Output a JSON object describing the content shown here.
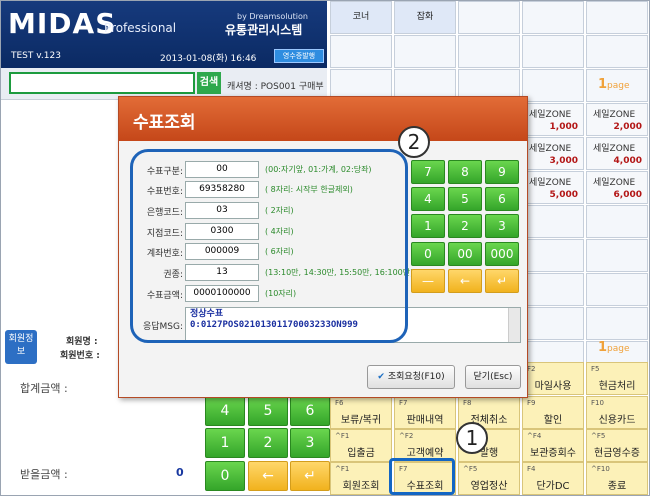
{
  "header": {
    "logo": "MIDAS",
    "logo_sub": "Professional",
    "by": "by Dreamsolution",
    "system": "유통관리시스템",
    "version": "TEST v.123",
    "datetime": "2013-01-08(화) 16:46",
    "receipt_btn": "영수증발행"
  },
  "search": {
    "button": "검색",
    "cashier": "캐셔명 : POS001 구매부"
  },
  "grid": {
    "top_tabs": [
      "코너",
      "잡화"
    ],
    "page1": "1",
    "page1_unit": "page",
    "page2": "1",
    "page2_unit": "page",
    "zones": [
      {
        "label": "세일ZONE",
        "price": "1,000"
      },
      {
        "label": "세일ZONE",
        "price": "2,000"
      },
      {
        "label": "세일ZONE",
        "price": "3,000"
      },
      {
        "label": "세일ZONE",
        "price": "4,000"
      },
      {
        "label": "세일ZONE",
        "price": "5,000"
      },
      {
        "label": "세일ZONE",
        "price": "6,000"
      }
    ]
  },
  "member": {
    "tab": "회원정보",
    "name_label": "회원명 :",
    "no_label": "회원번호 :"
  },
  "totals": {
    "total_label": "합계금액 :",
    "paid_label": "받을금액 :",
    "paid_value": "0"
  },
  "numpad": {
    "keys": [
      "4",
      "5",
      "6",
      "1",
      "2",
      "3",
      "0",
      "←",
      "↵"
    ]
  },
  "fkeys": [
    {
      "code": "F2",
      "label": "마일사용"
    },
    {
      "code": "F5",
      "label": "현금처리"
    },
    {
      "code": "F6",
      "label": "보류/복귀"
    },
    {
      "code": "F7",
      "label": "판매내역"
    },
    {
      "code": "F8",
      "label": "전체취소"
    },
    {
      "code": "F9",
      "label": "할인"
    },
    {
      "code": "F10",
      "label": "신용카드"
    },
    {
      "code": "^F1",
      "label": "입출금"
    },
    {
      "code": "^F2",
      "label": "고객예약"
    },
    {
      "code": "^F3",
      "label": "발행"
    },
    {
      "code": "^F4",
      "label": "보관증회수"
    },
    {
      "code": "^F5",
      "label": "현금영수증"
    },
    {
      "code": "^F1",
      "label": "회원조회"
    },
    {
      "code": "F7",
      "label": "수표조회"
    },
    {
      "code": "^F5",
      "label": "영업정산"
    },
    {
      "code": "F4",
      "label": "단가DC"
    },
    {
      "code": "^F10",
      "label": "종료"
    }
  ],
  "dialog": {
    "title": "수표조회",
    "fields": [
      {
        "label": "수표구분:",
        "value": "00",
        "hint": "(00:자기앞, 01:가계, 02:당좌)"
      },
      {
        "label": "수표번호:",
        "value": "69358280",
        "hint": "( 8자리: 시작부 한글제외)"
      },
      {
        "label": "은행코드:",
        "value": "03",
        "hint": "( 2자리)"
      },
      {
        "label": "지점코드:",
        "value": "0300",
        "hint": "( 4자리)"
      },
      {
        "label": "계좌번호:",
        "value": "000009",
        "hint": "( 6자리)"
      },
      {
        "label": "권종:",
        "value": "13",
        "hint": "(13:10만, 14:30만, 15:50만, 16:100만)"
      },
      {
        "label": "수표금액:",
        "value": "0000100000",
        "hint": "(10자리)"
      }
    ],
    "resp_label": "응답MSG:",
    "resp_line1": "정상수표",
    "resp_line2": "0:0127POS02101301170003233ON999",
    "keypad": [
      "7",
      "8",
      "9",
      "4",
      "5",
      "6",
      "1",
      "2",
      "3",
      "0",
      "00",
      "000",
      "—",
      "←",
      "↵"
    ],
    "btn_query": "조회요청(F10)",
    "btn_close": "닫기(Esc)"
  },
  "callouts": {
    "one": "1",
    "two": "2"
  }
}
